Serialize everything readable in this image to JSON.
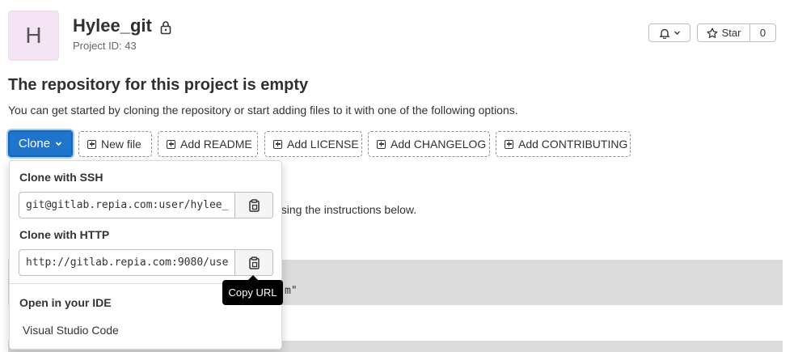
{
  "project": {
    "avatar_letter": "H",
    "name": "Hylee_git",
    "id_text": "Project ID: 43"
  },
  "header_actions": {
    "star_label": "Star",
    "star_count": "0"
  },
  "empty_state": {
    "title": "The repository for this project is empty",
    "description": "You can get started by cloning the repository or start adding files to it with one of the following options."
  },
  "toolbar": {
    "clone_label": "Clone",
    "buttons": [
      "New file",
      "Add README",
      "Add LICENSE",
      "Add CHANGELOG",
      "Add CONTRIBUTING"
    ]
  },
  "background": {
    "instructions_tail": "using the instructions below.",
    "code_tail": "m\""
  },
  "clone_dropdown": {
    "ssh_label": "Clone with SSH",
    "ssh_url": "git@gitlab.repia.com:user/hylee_",
    "http_label": "Clone with HTTP",
    "http_url": "http://gitlab.repia.com:9080/use",
    "ide_heading": "Open in your IDE",
    "ide_option": "Visual Studio Code"
  },
  "tooltip": "Copy URL",
  "colors": {
    "primary": "#1f75cb",
    "avatar_bg": "#f4e4f4"
  }
}
